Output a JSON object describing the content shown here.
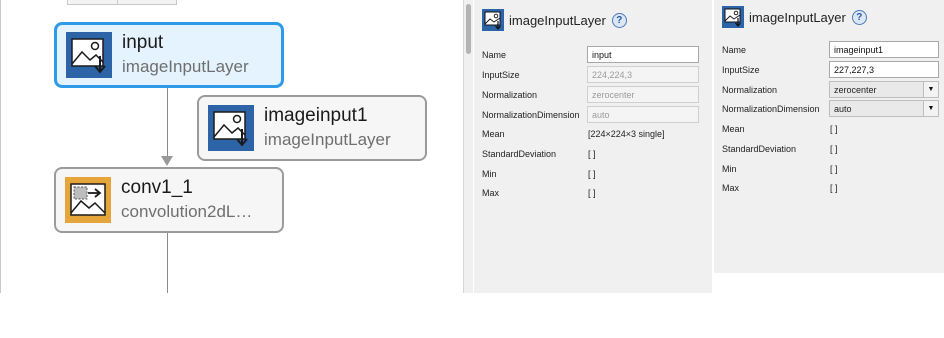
{
  "canvas": {
    "nodes": [
      {
        "name": "input",
        "type": "imageInputLayer",
        "icon": "image-input-layer-icon",
        "selected": true
      },
      {
        "name": "imageinput1",
        "type": "imageInputLayer",
        "icon": "image-input-layer-icon",
        "selected": false
      },
      {
        "name": "conv1_1",
        "type": "convolution2dL…",
        "icon": "convolution2d-layer-icon",
        "selected": false
      }
    ]
  },
  "panel_left": {
    "title": "imageInputLayer",
    "help_glyph": "?",
    "properties": [
      {
        "label": "Name",
        "value": "input",
        "kind": "input"
      },
      {
        "label": "InputSize",
        "value": "224,224,3",
        "kind": "disabled"
      },
      {
        "label": "Normalization",
        "value": "zerocenter",
        "kind": "disabled"
      },
      {
        "label": "NormalizationDimension",
        "value": "auto",
        "kind": "disabled"
      },
      {
        "label": "Mean",
        "value": "[224×224×3 single]",
        "kind": "text"
      },
      {
        "label": "StandardDeviation",
        "value": "[ ]",
        "kind": "text"
      },
      {
        "label": "Min",
        "value": "[ ]",
        "kind": "text"
      },
      {
        "label": "Max",
        "value": "[ ]",
        "kind": "text"
      }
    ]
  },
  "panel_right": {
    "title": "imageInputLayer",
    "help_glyph": "?",
    "properties": [
      {
        "label": "Name",
        "value": "imageinput1",
        "kind": "input"
      },
      {
        "label": "InputSize",
        "value": "227,227,3",
        "kind": "input"
      },
      {
        "label": "Normalization",
        "value": "zerocenter",
        "kind": "select"
      },
      {
        "label": "NormalizationDimension",
        "value": "auto",
        "kind": "select"
      },
      {
        "label": "Mean",
        "value": "[ ]",
        "kind": "text"
      },
      {
        "label": "StandardDeviation",
        "value": "[ ]",
        "kind": "text"
      },
      {
        "label": "Min",
        "value": "[ ]",
        "kind": "text"
      },
      {
        "label": "Max",
        "value": "[ ]",
        "kind": "text"
      }
    ]
  },
  "colors": {
    "selected_border": "#2f9be8",
    "selected_fill": "#e4f3fd",
    "input_icon_bg": "#2d64a8",
    "conv_icon_bg": "#e6a53b",
    "panel_bg": "#f0f0f0"
  }
}
